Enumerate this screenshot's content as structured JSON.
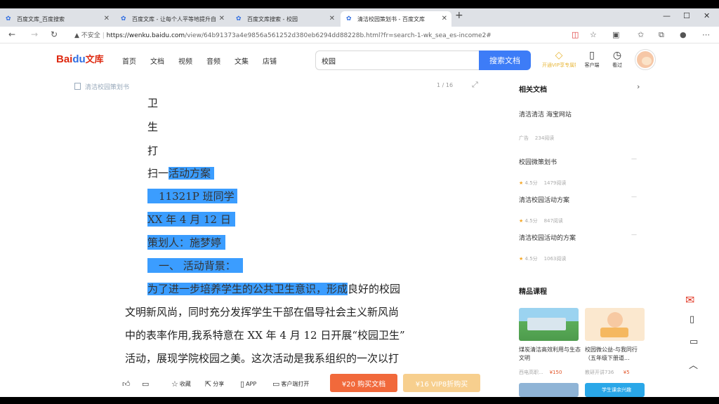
{
  "tabs": [
    {
      "title": "百度文库_百度搜索"
    },
    {
      "title": "百度文库 - 让每个人平等地提升自"
    },
    {
      "title": "百度文库搜索 - 校园"
    },
    {
      "title": "清洁校园策划书 - 百度文库"
    }
  ],
  "address": {
    "security": "不安全",
    "domain": "https://wenku.baidu.com",
    "path": "/view/64b91373a4e9856a561252d380eb6294dd88228b.html?fr=search-1-wk_sea_es-income2#"
  },
  "logo": {
    "main": "Bai",
    "paw": "du",
    "suffix": "文库"
  },
  "menu": [
    "首页",
    "文档",
    "视频",
    "音频",
    "文集",
    "店铺"
  ],
  "search": {
    "value": "校园",
    "button": "搜索文档"
  },
  "header_icons": {
    "vip": "开通VIP享专属特权",
    "client": "客户端",
    "history": "看过"
  },
  "doc": {
    "title": "清洁校园策划书",
    "pager": "1 / 16"
  },
  "content": {
    "v1": "卫",
    "v2": "生",
    "v3": "打",
    "l1_plain": "扫一",
    "l1_hl": "活动方案",
    "l2": "11321P 班同学",
    "l3": "XX 年 4 月 12 日",
    "l4": "策划人：施梦婷",
    "l5": "一、 活动背景：",
    "l6_hl": "为了进一步培养学生的公共卫生意识，形成",
    "l6_plain": "良好的校园",
    "l7": "文明新风尚，同时充分发挥学生干部在倡导社会主义新风尚",
    "l8": "中的表率作用,我系特意在 XX 年 4 月 12 日开展“校园卫生”",
    "l9": "活动，展现学院校园之美。这次活动是我系组织的一次以打"
  },
  "sidebar": {
    "related_title": "相关文档",
    "items": [
      {
        "title": "清洁清洁 海宝网站",
        "meta_a": "广告",
        "meta_b": "234阅读"
      },
      {
        "title": "校园微策划书",
        "rating": "4.5分",
        "reads": "1479阅读"
      },
      {
        "title": "清洁校园活动方案",
        "rating": "4.5分",
        "reads": "847阅读"
      },
      {
        "title": "清洁校园活动的方案",
        "rating": "4.5分",
        "reads": "1063阅读"
      }
    ],
    "courses_title": "精品课程",
    "courses": [
      {
        "title": "煤炭清洁高效利用与生态文明",
        "author": "西电高职...",
        "price": "¥150"
      },
      {
        "title": "校园微公益-与我同行（五年级下册道...",
        "author": "教研开讲736",
        "price": "¥5"
      }
    ],
    "banner_text": "学生课余兴趣"
  },
  "bottom": {
    "like": "",
    "comment": "",
    "favorite": "收藏",
    "share": "分享",
    "app": "APP",
    "client_open": "客户端打开",
    "buy": "¥20 购买文档",
    "vip_buy": "¥16 VIP8折购买"
  },
  "colors": {
    "accent": "#3d7cf7",
    "highlight": "#3b9dff",
    "buy": "#f1693b",
    "vip": "#f7cf8e",
    "logo_red": "#de2910"
  }
}
